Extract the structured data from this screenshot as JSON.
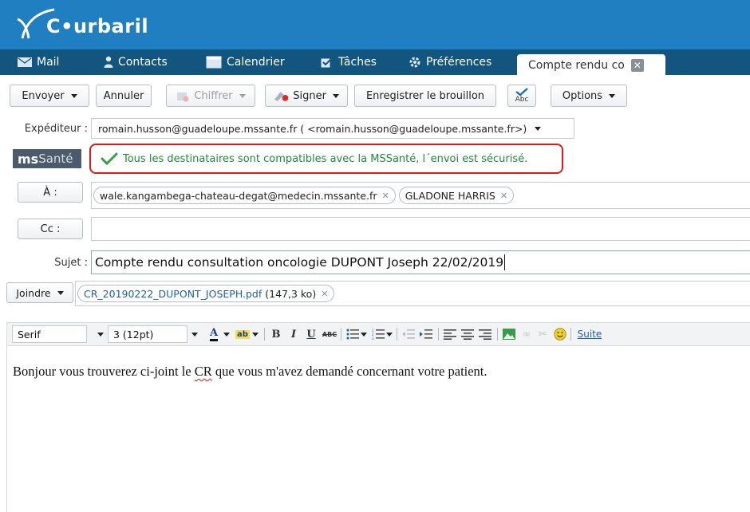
{
  "app": {
    "logo_text": "C•urbaril",
    "colors": {
      "header": "#1f7fc0",
      "navbar": "#12567f",
      "secure_green": "#1f8b3a",
      "highlight_red": "#e0181f"
    }
  },
  "nav": {
    "items": [
      {
        "label": "Mail",
        "icon": "mail-icon"
      },
      {
        "label": "Contacts",
        "icon": "contacts-icon"
      },
      {
        "label": "Calendrier",
        "icon": "calendar-icon"
      },
      {
        "label": "Tâches",
        "icon": "tasks-icon"
      },
      {
        "label": "Préférences",
        "icon": "gear-icon"
      }
    ],
    "active_tab": {
      "label": "Compte rendu co",
      "close_icon": "close-icon"
    }
  },
  "toolbar": {
    "send": "Envoyer",
    "cancel": "Annuler",
    "encrypt": "Chiffrer",
    "sign": "Signer",
    "save_draft": "Enregistrer le brouillon",
    "spellcheck_label": "Abc",
    "options": "Options"
  },
  "form": {
    "sender_label": "Expéditeur :",
    "sender_value": "romain.husson@guadeloupe.mssante.fr ( <romain.husson@guadeloupe.mssante.fr>)",
    "mssante_badge_bold": "ms",
    "mssante_badge_rest": "Santé",
    "secure_message": "Tous les destinataires sont compatibles avec la MSSanté, l´envoi est sécurisé.",
    "to_button": "À :",
    "to_recipients": [
      "wale.kangambega-chateau-degat@medecin.mssante.fr",
      "GLADONE HARRIS"
    ],
    "cc_button": "Cc :",
    "subject_label": "Sujet :",
    "subject_value": "Compte rendu consultation oncologie DUPONT Joseph 22/02/2019",
    "attach_button": "Joindre",
    "attachment_name": "CR_20190222_DUPONT_JOSEPH.pdf",
    "attachment_size": "(147,3 ko)"
  },
  "editor": {
    "font_family": "Serif",
    "font_size": "3 (12pt)",
    "suite_link": "Suite",
    "body_before": "Bonjour vous trouverez ci-joint le ",
    "body_misspelled": "CR",
    "body_after": " que vous m'avez demandé concernant votre patient."
  }
}
